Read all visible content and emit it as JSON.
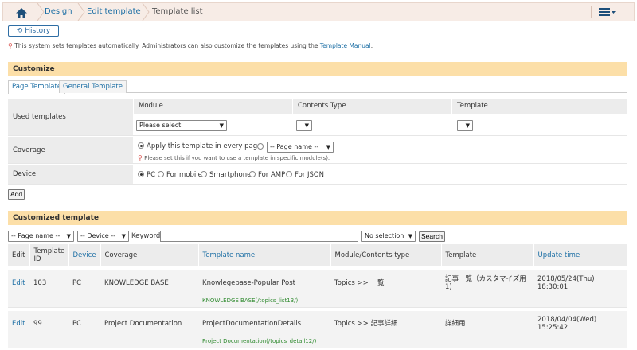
{
  "breadcrumb": {
    "items": [
      "Design",
      "Edit template",
      "Template list"
    ]
  },
  "history": {
    "label": "History"
  },
  "notice": {
    "text": "This system sets templates automatically. Administrators can also customize the templates using the ",
    "link": "Template Manual",
    "end": "."
  },
  "customize": {
    "title": "Customize",
    "tabs": [
      "Page Template",
      "General Template"
    ],
    "used_templates": {
      "label": "Used templates",
      "headers": [
        "Module",
        "Contents Type",
        "Template"
      ],
      "module_value": "Please select"
    },
    "coverage": {
      "label": "Coverage",
      "option_every_page": "Apply this template in every page",
      "page_name_value": "-- Page name --",
      "hint": "Please set this if you want to use a template in specific module(s)."
    },
    "device": {
      "label": "Device",
      "options": [
        "PC",
        "For mobile",
        "Smartphone",
        "For AMP",
        "For JSON"
      ]
    },
    "add_label": "Add"
  },
  "customized": {
    "title": "Customized template",
    "filters": {
      "page_name": "-- Page name --",
      "device": "-- Device --",
      "keyword_label": "Keyword:",
      "selection": "No selection",
      "search_label": "Search"
    },
    "headers": [
      "Edit",
      "Template ID",
      "Device",
      "Coverage",
      "Template name",
      "Module/Contents type",
      "Template",
      "Update time"
    ],
    "rows": [
      {
        "edit": "Edit",
        "id": "103",
        "device": "PC",
        "coverage": "KNOWLEDGE BASE",
        "name": "Knowlegebase-Popular Post",
        "module": "Topics >> 一覧",
        "template": "記事一覧（カスタマイズ用 1)",
        "updated": "2018/05/24(Thu) 18:30:01",
        "path": "KNOWLEDGE BASE(/topics_list13/)"
      },
      {
        "edit": "Edit",
        "id": "99",
        "device": "PC",
        "coverage": "Project Documentation",
        "name": "ProjectDocumentationDetails",
        "module": "Topics >> 記事詳細",
        "template": "詳細用",
        "updated": "2018/04/04(Wed) 15:25:42",
        "path": "Project Documentation(/topics_detail12/)"
      }
    ]
  },
  "colors": {
    "breadcrumb_bg": "#f7ece6",
    "section_header_bg": "#fcdfa8",
    "link": "#1d6fa5",
    "path_green": "#2f8a2f"
  }
}
